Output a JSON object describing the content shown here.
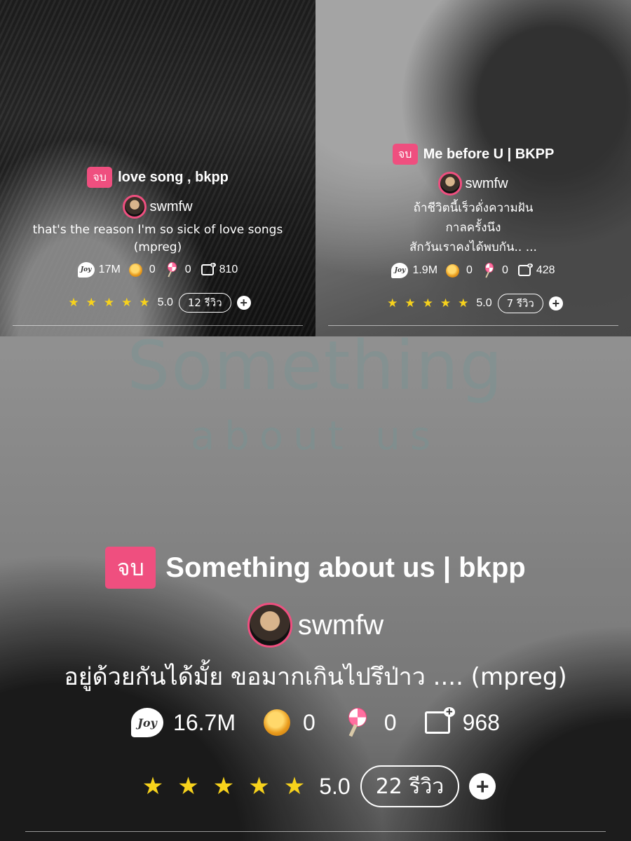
{
  "stories": [
    {
      "status_badge": "จบ",
      "title": "love song , bkpp",
      "author": "swmfw",
      "description": "that's the reason I'm so sick of love songs (mpreg)",
      "stats": {
        "joy": "17M",
        "coins": "0",
        "candy": "0",
        "chapters": "810"
      },
      "rating": "5.0",
      "reviews": "12 รีวิว"
    },
    {
      "status_badge": "จบ",
      "title": "Me before U | BKPP",
      "author": "swmfw",
      "description_lines": [
        "ถ้าชีวิตนี้เร็วดั่งความฝัน",
        "กาลครั้งนึง",
        "สักวันเราคงได้พบกัน.. ..."
      ],
      "stats": {
        "joy": "1.9M",
        "coins": "0",
        "candy": "0",
        "chapters": "428"
      },
      "rating": "5.0",
      "reviews": "7 รีวิว"
    },
    {
      "status_badge": "จบ",
      "title": "Something about us | bkpp",
      "author": "swmfw",
      "description": "อยู่ด้วยกันได้มั้ย ขอมากเกินไปรึป่าว .... (mpreg)",
      "stats": {
        "joy": "16.7M",
        "coins": "0",
        "candy": "0",
        "chapters": "968"
      },
      "rating": "5.0",
      "reviews": "22 รีวิว"
    }
  ],
  "cover_text": {
    "line1": "Something",
    "line2": "about us"
  },
  "icons": {
    "joy": "joy-icon",
    "coin": "coin-icon",
    "candy": "candy-icon",
    "chapter": "chapter-add-icon",
    "star": "star-icon",
    "add": "plus-circle-icon"
  },
  "colors": {
    "badge": "#ef4f7f",
    "star": "#f7d21c"
  }
}
